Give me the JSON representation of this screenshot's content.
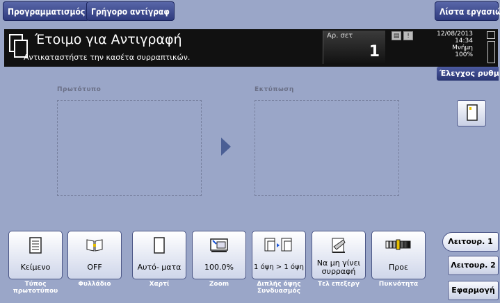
{
  "tabs": {
    "programming": "Προγραμματισμός",
    "quick_copy": "Γρήγορο αντίγραφ",
    "job_list": "Λίστα εργασιών"
  },
  "status": {
    "title": "Έτοιμο για Αντιγραφή",
    "message": "Αντικαταστήστε την κασέτα συρραπτικών.",
    "copies_label": "Αρ. σετ",
    "copies_value": "1",
    "date": "12/08/2013",
    "time": "14:34",
    "memory_label": "Μνήμη",
    "memory_value": "100%"
  },
  "check_settings": "Έλεγχος ρυθμίσε",
  "areas": {
    "original_label": "Πρωτότυπο",
    "output_label": "Εκτύπωση"
  },
  "bottom_buttons": [
    {
      "name": "original-type",
      "value": "Κείμενο",
      "label": "Τύπος πρωτοτύπου",
      "icon": "document-icon"
    },
    {
      "name": "booklet",
      "value": "OFF",
      "label": "Φυλλάδιο",
      "icon": "booklet-icon"
    },
    {
      "name": "paper",
      "value": "Αυτό- ματα",
      "label": "Χαρτί",
      "icon": "paper-icon"
    },
    {
      "name": "zoom",
      "value": "100.0%",
      "label": "Zoom",
      "icon": "zoom-icon"
    },
    {
      "name": "duplex",
      "value": "1 όψη > 1 όψη",
      "label": "Διπλής όψης Συνδυασμός",
      "icon": "duplex-icon"
    },
    {
      "name": "finishing",
      "value": "Να μη γίνει συρραφή",
      "label": "Τελ επεξεργ",
      "icon": "staple-icon"
    },
    {
      "name": "density",
      "value": "Προε",
      "label": "Πυκνότητα",
      "icon": "density-icon"
    }
  ],
  "side": {
    "function1": "Λειτουρ. 1",
    "function2": "Λειτουρ. 2",
    "apply": "Εφαρμογή"
  }
}
